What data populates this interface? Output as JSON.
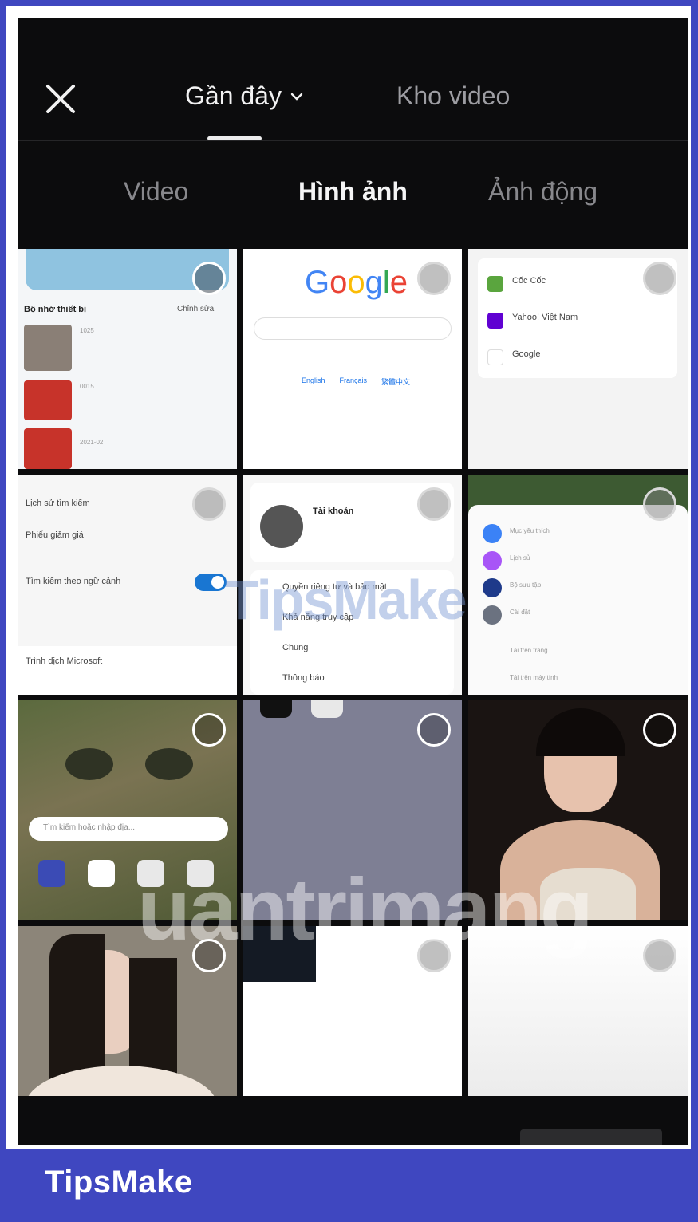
{
  "header": {
    "close_icon": "close-icon",
    "tab_recent_label": "Gần đây",
    "tab_library_label": "Kho video"
  },
  "subtabs": [
    {
      "label": "Video",
      "active": false
    },
    {
      "label": "Hình ảnh",
      "active": true
    },
    {
      "label": "Ảnh động",
      "active": false
    }
  ],
  "tiles": {
    "t1": {
      "row1": "Bộ nhớ thiết bị",
      "row2": "Chỉnh sửa",
      "items": [
        "1025",
        "0015",
        "2021-02"
      ]
    },
    "t2": {
      "logo": "Google",
      "links": [
        "English",
        "Français",
        "繁體中文"
      ]
    },
    "t3": {
      "items": [
        "Cốc Cốc",
        "Yahoo! Việt Nam",
        "Google"
      ]
    },
    "t4": {
      "items": [
        "Lịch sử tìm kiếm",
        "Phiếu giảm giá",
        "Tìm kiếm theo ngữ cảnh",
        "Trình dịch Microsoft"
      ]
    },
    "t5": {
      "account": "Tài khoản",
      "items": [
        "Quyền riêng tư và bảo mật",
        "Khả năng truy cập",
        "Chung",
        "Thông báo"
      ]
    },
    "t6": {
      "items": [
        "Mục yêu thích",
        "Lịch sử",
        "Bộ sưu tập",
        "Cài đặt",
        "Tải trên trang",
        "Tải trên máy tính"
      ]
    },
    "t7": {
      "search_placeholder": "Tìm kiếm hoặc nhập địa..."
    }
  },
  "watermarks": {
    "tipsmake": "TipsMake",
    "quantrimang": "uantrimang"
  },
  "brand": "TipsMake",
  "colors": {
    "frame_border": "#3f47c0",
    "background": "#0c0c0d",
    "toggle_on": "#1976d2"
  }
}
